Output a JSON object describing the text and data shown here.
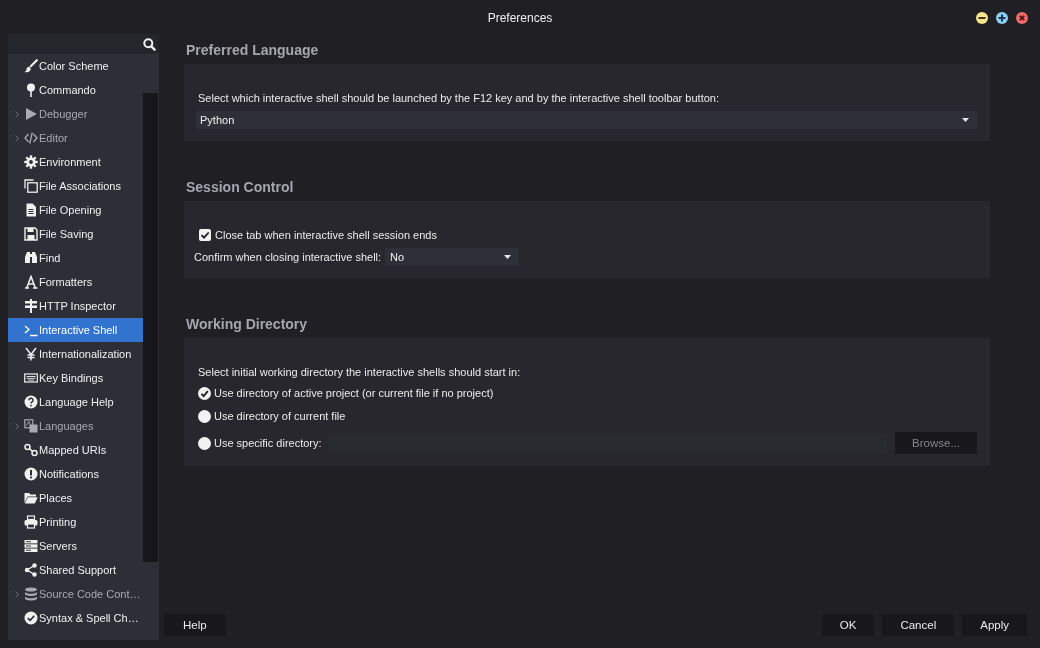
{
  "window": {
    "title": "Preferences"
  },
  "sidebar": {
    "items": [
      {
        "label": "Color Scheme",
        "selected": false,
        "expandable": false
      },
      {
        "label": "Commando",
        "selected": false,
        "expandable": false
      },
      {
        "label": "Debugger",
        "selected": false,
        "expandable": true
      },
      {
        "label": "Editor",
        "selected": false,
        "expandable": true
      },
      {
        "label": "Environment",
        "selected": false,
        "expandable": false
      },
      {
        "label": "File Associations",
        "selected": false,
        "expandable": false
      },
      {
        "label": "File Opening",
        "selected": false,
        "expandable": false
      },
      {
        "label": "File Saving",
        "selected": false,
        "expandable": false
      },
      {
        "label": "Find",
        "selected": false,
        "expandable": false
      },
      {
        "label": "Formatters",
        "selected": false,
        "expandable": false
      },
      {
        "label": "HTTP Inspector",
        "selected": false,
        "expandable": false
      },
      {
        "label": "Interactive Shell",
        "selected": true,
        "expandable": false
      },
      {
        "label": "Internationalization",
        "selected": false,
        "expandable": false
      },
      {
        "label": "Key Bindings",
        "selected": false,
        "expandable": false
      },
      {
        "label": "Language Help",
        "selected": false,
        "expandable": false
      },
      {
        "label": "Languages",
        "selected": false,
        "expandable": true
      },
      {
        "label": "Mapped URIs",
        "selected": false,
        "expandable": false
      },
      {
        "label": "Notifications",
        "selected": false,
        "expandable": false
      },
      {
        "label": "Places",
        "selected": false,
        "expandable": false
      },
      {
        "label": "Printing",
        "selected": false,
        "expandable": false
      },
      {
        "label": "Servers",
        "selected": false,
        "expandable": false
      },
      {
        "label": "Shared Support",
        "selected": false,
        "expandable": false
      },
      {
        "label": "Source Code Cont…",
        "selected": false,
        "expandable": true
      },
      {
        "label": "Syntax & Spell Ch…",
        "selected": false,
        "expandable": false
      }
    ]
  },
  "sections": [
    {
      "title": "Preferred Language",
      "controls": [
        {
          "kind": "label",
          "text": "Select which interactive shell should be launched by the F12 key and by the interactive shell toolbar button:"
        },
        {
          "kind": "dropdown",
          "value": "Python"
        }
      ]
    },
    {
      "title": "Session Control",
      "controls": [
        {
          "kind": "checkbox",
          "label": "Close tab when interactive shell session ends",
          "checked": true
        },
        {
          "kind": "labeled-dropdown",
          "label": "Confirm when closing interactive shell:",
          "value": "No"
        }
      ]
    },
    {
      "title": "Working Directory",
      "controls": [
        {
          "kind": "label",
          "text": "Select initial working directory the interactive shells should start in:"
        },
        {
          "kind": "radio",
          "label": "Use directory of active project (or current file if no project)",
          "selected": true
        },
        {
          "kind": "radio",
          "label": "Use directory of current file",
          "selected": false
        },
        {
          "kind": "radio-path",
          "label": "Use specific directory:",
          "selected": false,
          "button": {
            "label": "Browse...",
            "disabled": true
          }
        }
      ]
    }
  ],
  "help_button": {
    "label": "Help"
  },
  "dialog_buttons": [
    {
      "label": "OK"
    },
    {
      "label": "Cancel"
    },
    {
      "label": "Apply"
    }
  ]
}
